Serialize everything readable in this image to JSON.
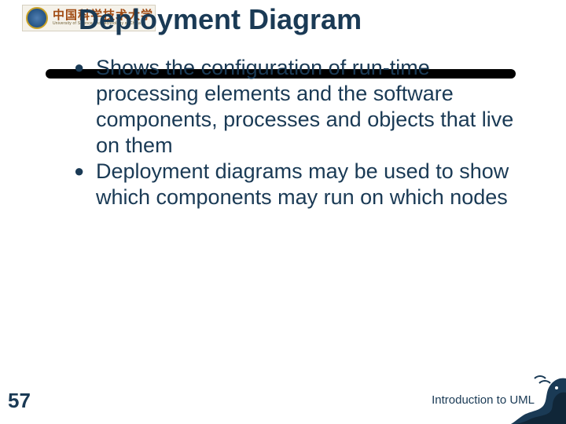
{
  "logo": {
    "zh_text": "中国科学技术大学",
    "en_text": "University of Science and Technology of China"
  },
  "title": "Deployment Diagram",
  "bullets": [
    "Shows the configuration of run-time processing elements and the software components, processes and objects that live on them",
    "Deployment diagrams may be used to show which components may run on which nodes"
  ],
  "page_number": "57",
  "footer": "Introduction to UML"
}
